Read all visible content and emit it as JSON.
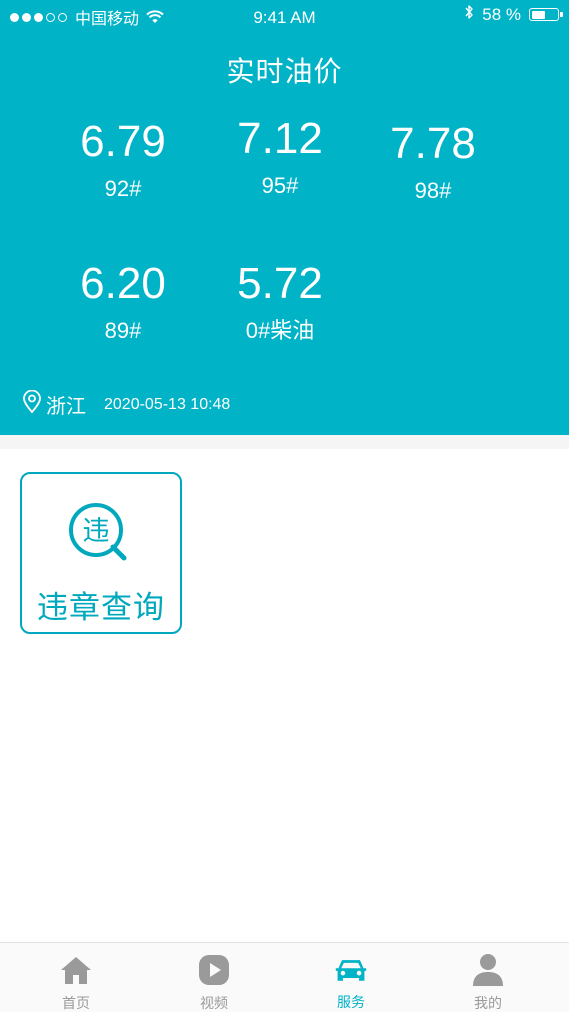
{
  "status_bar": {
    "carrier": "中国移动",
    "time": "9:41 AM",
    "battery_percent": "58 %",
    "battery_level": 0.58,
    "signal_strength": 3,
    "signal_max": 5
  },
  "header": {
    "title": "实时油价",
    "background_color": "#00b3c6"
  },
  "prices": [
    {
      "value": "6.79",
      "label": "92#"
    },
    {
      "value": "7.12",
      "label": "95#"
    },
    {
      "value": "7.78",
      "label": "98#"
    },
    {
      "value": "6.20",
      "label": "89#"
    },
    {
      "value": "5.72",
      "label": "0#柴油"
    }
  ],
  "location": {
    "icon": "location-pin-icon",
    "name": "浙江",
    "updated": "2020-05-13 10:48"
  },
  "services": [
    {
      "label": "违章查询",
      "icon_char": "违",
      "icon": "violation-search-icon",
      "color": "#00a8bd"
    }
  ],
  "tab_bar": {
    "active_color": "#00b3c6",
    "inactive_color": "#9a9a9a",
    "tabs": [
      {
        "label": "首页",
        "icon": "home-icon",
        "active": false
      },
      {
        "label": "视频",
        "icon": "video-play-icon",
        "active": false
      },
      {
        "label": "服务",
        "icon": "car-icon",
        "active": true
      },
      {
        "label": "我的",
        "icon": "person-icon",
        "active": false
      }
    ]
  }
}
